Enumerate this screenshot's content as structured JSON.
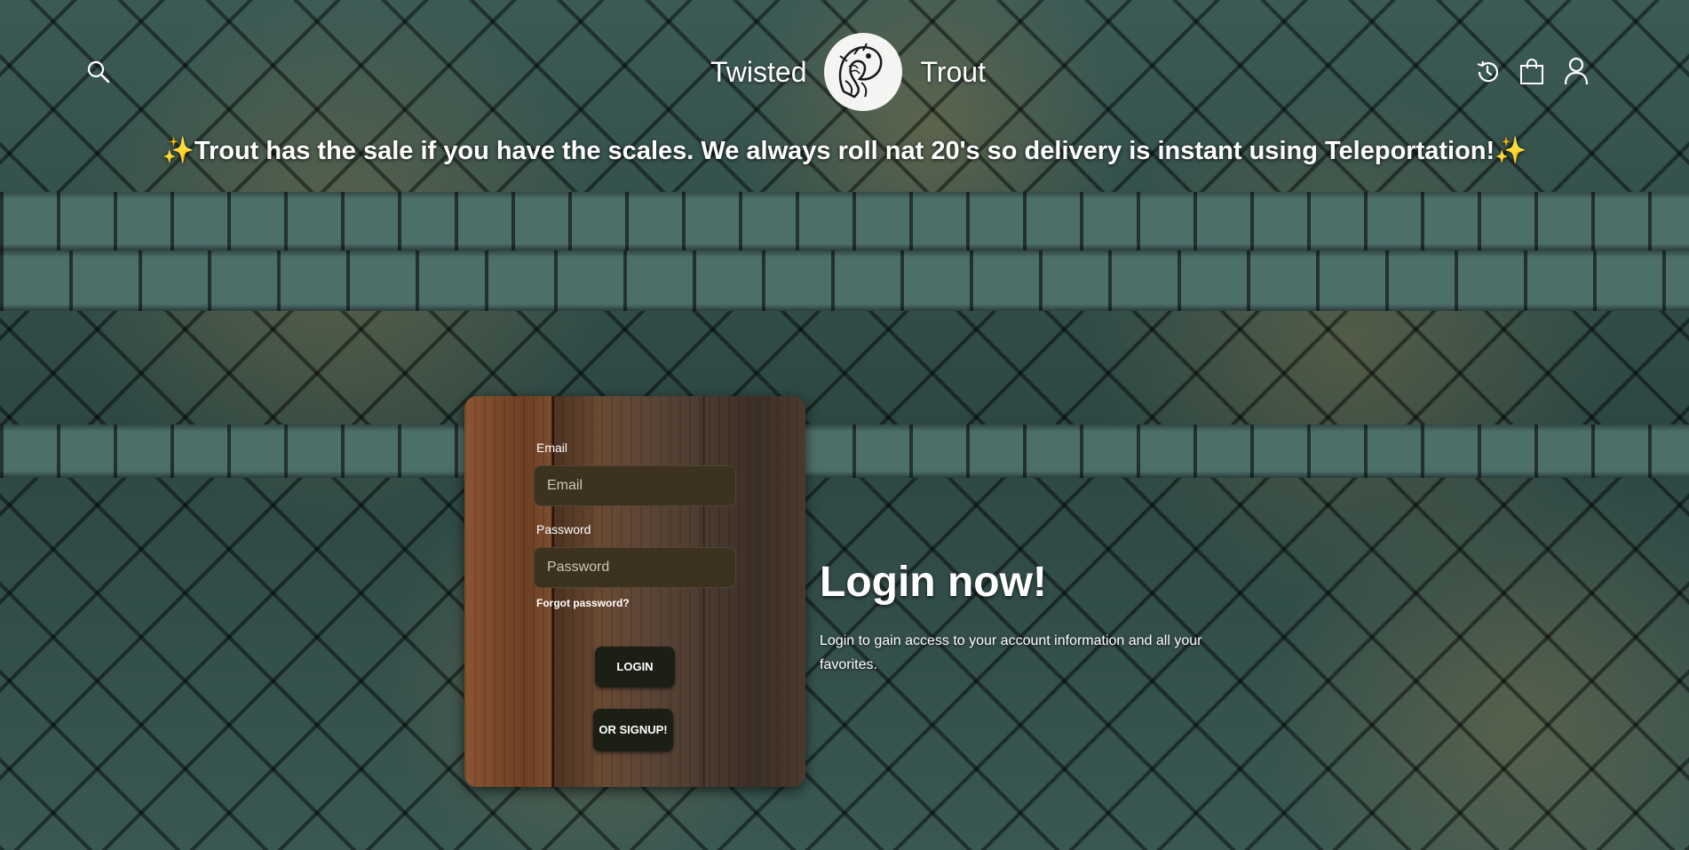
{
  "header": {
    "brand_left": "Twisted",
    "brand_right": "Trout",
    "icons": [
      "search-icon",
      "history-icon",
      "shopping-bag-icon",
      "user-icon"
    ]
  },
  "promo": {
    "sparkle_left": "✨",
    "text": "Trout has the sale if you have the scales. We always roll nat 20's so delivery is instant using Teleportation!",
    "sparkle_right": "✨"
  },
  "login_form": {
    "email_label": "Email",
    "email_placeholder": "Email",
    "email_value": "",
    "password_label": "Password",
    "password_placeholder": "Password",
    "password_value": "",
    "forgot_password": "Forgot password?",
    "login_button": "Login",
    "signup_button": "Or signup!"
  },
  "hero": {
    "title": "Login now!",
    "description": "Login to gain access to your account information and all your favorites."
  },
  "colors": {
    "button_bg": "#1b1f14",
    "input_bg": "#3d3220",
    "text": "#ffffff",
    "sparkle": "#ffd84a"
  }
}
